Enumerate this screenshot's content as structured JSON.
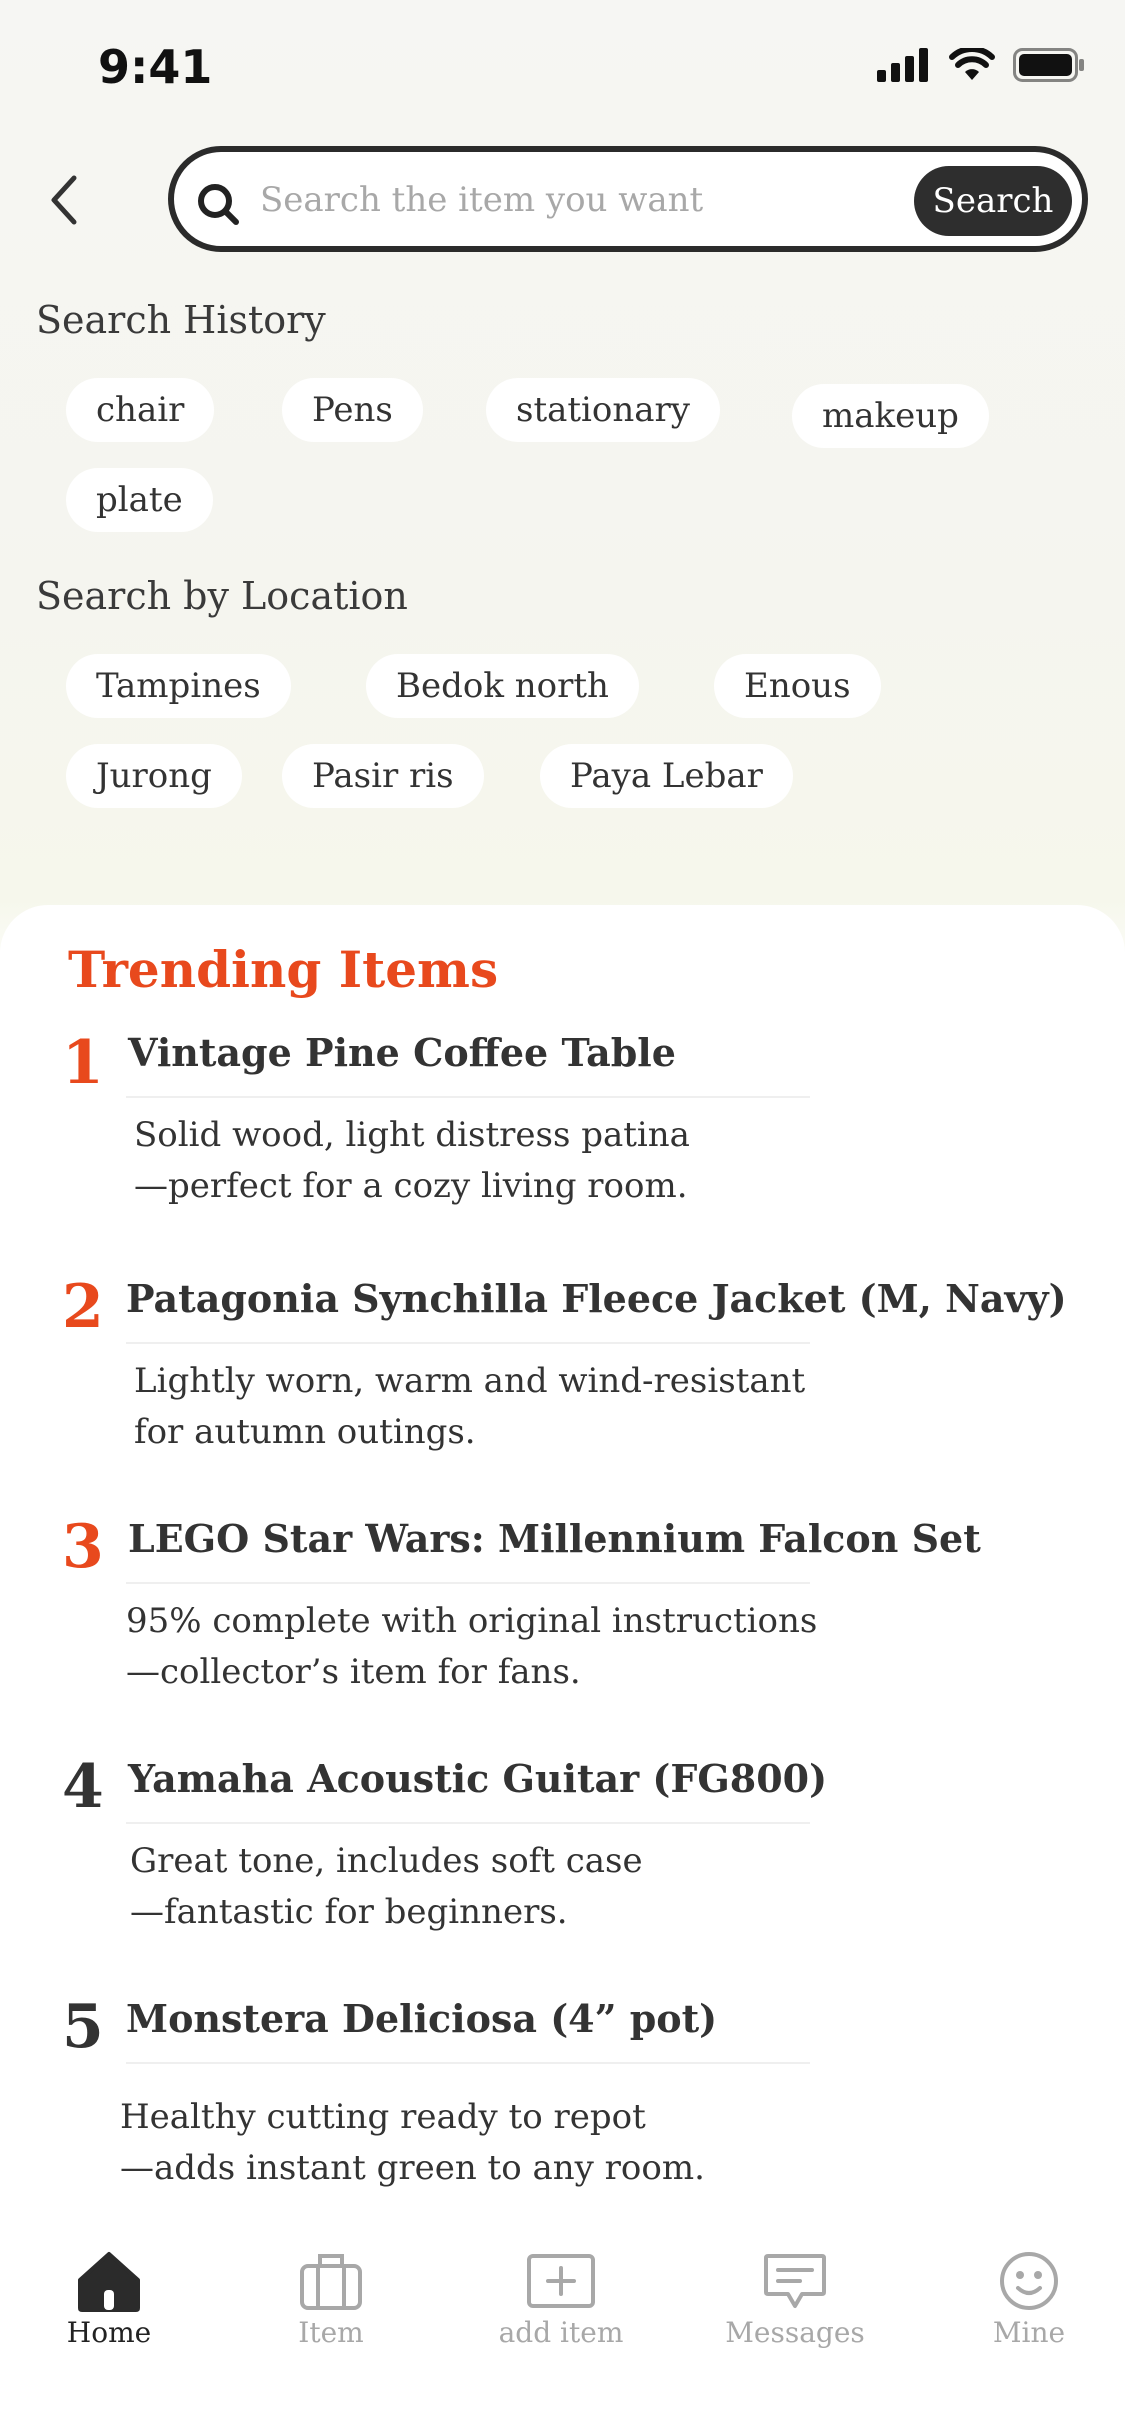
{
  "status_bar": {
    "time": "9:41"
  },
  "search": {
    "placeholder": "Search the item you want",
    "button_label": "Search"
  },
  "search_history": {
    "title": "Search History",
    "chips": [
      "chair",
      "Pens",
      "stationary",
      "makeup",
      "plate"
    ]
  },
  "search_location": {
    "title": "Search by Location",
    "chips": [
      "Tampines",
      "Bedok north",
      "Enous",
      "Jurong",
      "Pasir ris",
      "Paya Lebar"
    ]
  },
  "trending": {
    "title": "Trending Items",
    "accent_color": "#e8491d",
    "items": [
      {
        "rank": "1",
        "name": "Vintage Pine Coffee Table",
        "desc_line1": "Solid wood, light distress patina",
        "desc_line2": "—perfect for a cozy living room.",
        "highlight": true
      },
      {
        "rank": "2",
        "name": "Patagonia Synchilla Fleece Jacket (M, Navy)",
        "desc_line1": "Lightly worn, warm and wind-resistant",
        "desc_line2": "for autumn outings.",
        "highlight": true
      },
      {
        "rank": "3",
        "name": "LEGO Star Wars: Millennium Falcon Set",
        "desc_line1": "95% complete with original instructions",
        "desc_line2": "—collector’s item for fans.",
        "highlight": true
      },
      {
        "rank": "4",
        "name": "Yamaha Acoustic Guitar (FG800)",
        "desc_line1": "Great tone, includes soft case",
        "desc_line2": "—fantastic for beginners.",
        "highlight": false
      },
      {
        "rank": "5",
        "name": "Monstera Deliciosa (4” pot)",
        "desc_line1": "Healthy cutting ready to repot",
        "desc_line2": "—adds instant green to any room.",
        "highlight": false
      }
    ]
  },
  "tabbar": {
    "tabs": [
      {
        "label": "Home",
        "icon": "home-icon",
        "active": true
      },
      {
        "label": "Item",
        "icon": "briefcase-icon",
        "active": false
      },
      {
        "label": "add item",
        "icon": "add-box-icon",
        "active": false
      },
      {
        "label": "Messages",
        "icon": "message-icon",
        "active": false
      },
      {
        "label": "Mine",
        "icon": "smiley-icon",
        "active": false
      }
    ]
  }
}
